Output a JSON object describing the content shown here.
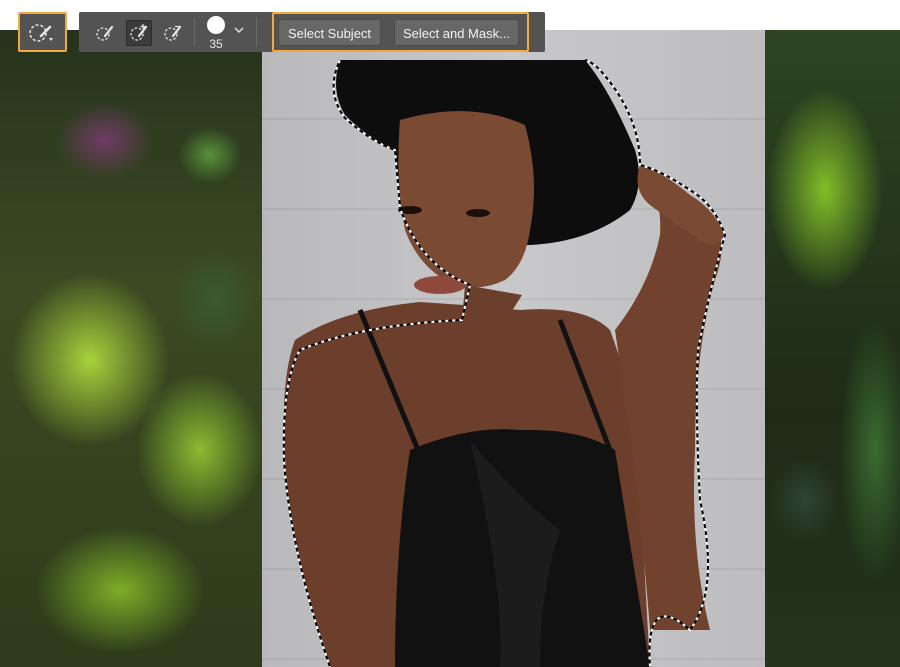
{
  "options_bar": {
    "tool_preset_icon": "quick-selection-brush-icon",
    "mode_icons": [
      "new-selection-brush-icon",
      "add-to-selection-brush-icon",
      "subtract-from-selection-brush-icon"
    ],
    "active_mode_index": 1,
    "brush_size": "35",
    "brush_picker_icon": "chevron-down-icon",
    "select_subject_label": "Select Subject",
    "select_and_mask_label": "Select and Mask..."
  },
  "colors": {
    "panel": "#535353",
    "highlight": "#f4a93b",
    "button": "#676767",
    "button_text": "#f2f2f2"
  }
}
